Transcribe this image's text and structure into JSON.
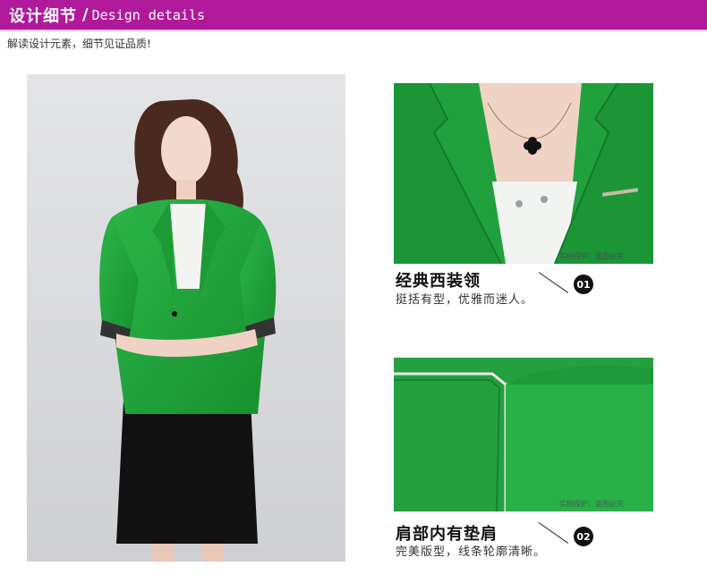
{
  "header": {
    "title_zh": "设计细节",
    "separator": "/",
    "title_en": "Design details",
    "color": "#b1199b"
  },
  "subtitle": "解读设计元素，细节见证品质!",
  "details": [
    {
      "title": "经典西装领",
      "text": "挺括有型，优雅而迷人。",
      "number": "01",
      "watermark": "实拍保护：盗图必究"
    },
    {
      "title": "肩部内有垫肩",
      "text": "完美版型，线条轮廓清晰。",
      "number": "02",
      "watermark": "实拍保护：盗图必究"
    }
  ],
  "colors": {
    "jacket_green": "#22a33d",
    "skirt_black": "#111111",
    "background_gray": "#d9dadc"
  }
}
